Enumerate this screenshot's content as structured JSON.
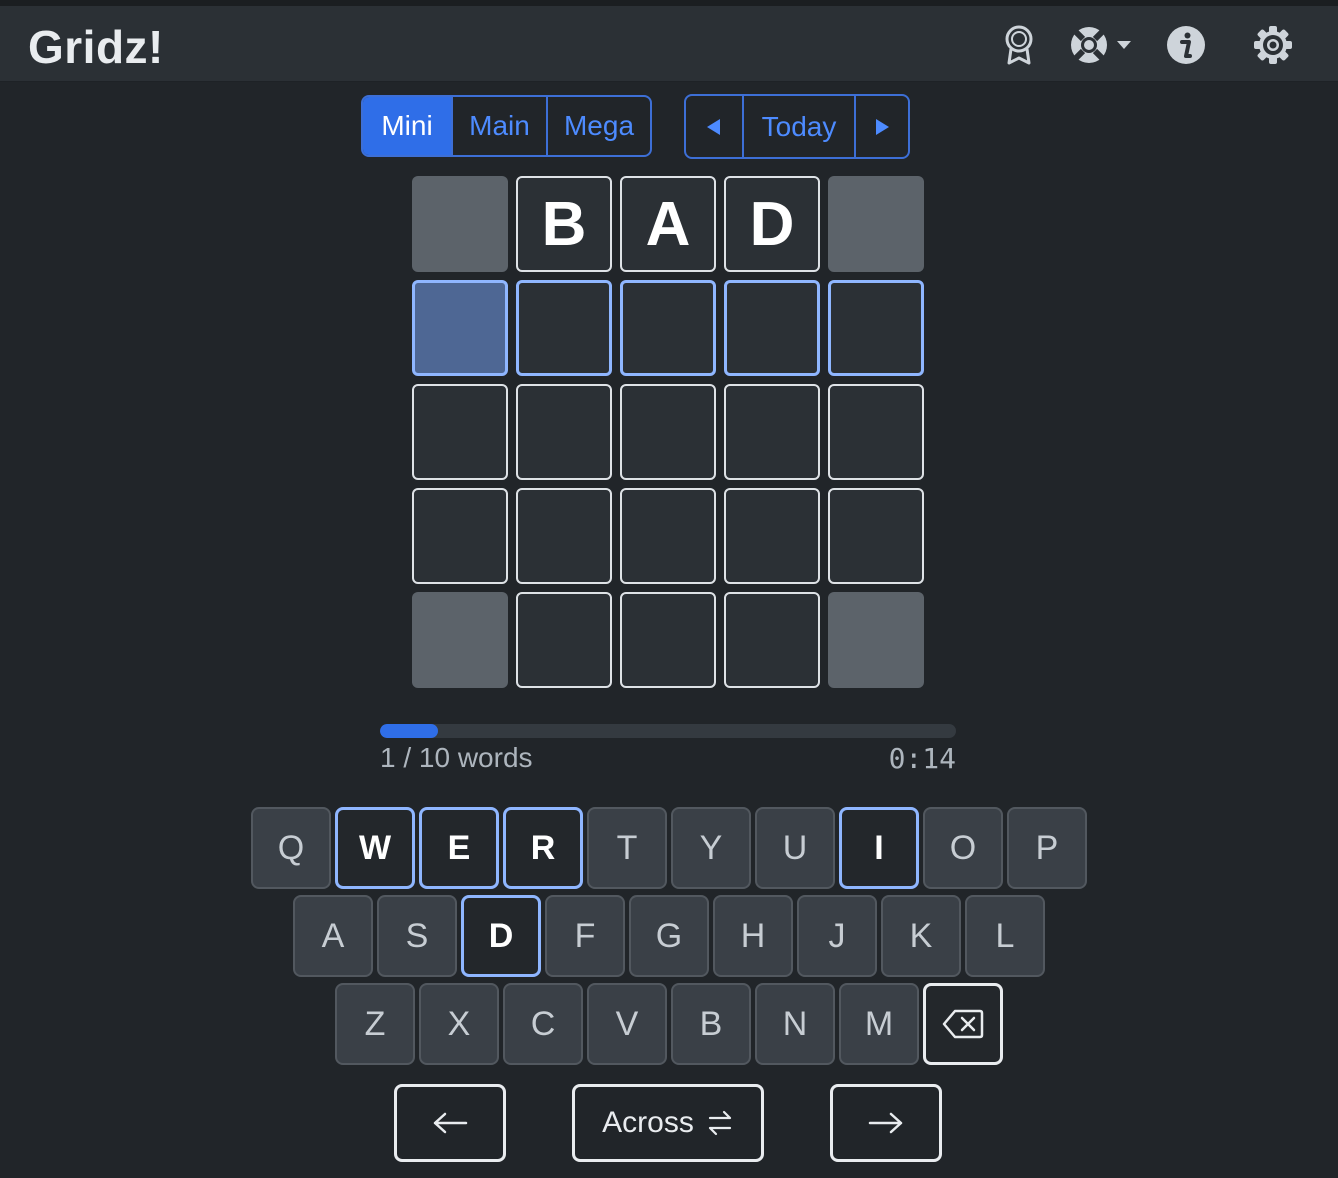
{
  "app": {
    "title": "Gridz!"
  },
  "navbar": {
    "icons": [
      "award-icon",
      "lifebuoy-icon",
      "info-icon",
      "gear-icon"
    ]
  },
  "modes": [
    {
      "label": "Mini",
      "active": true
    },
    {
      "label": "Main",
      "active": false
    },
    {
      "label": "Mega",
      "active": false
    }
  ],
  "date_nav": {
    "prev_icon": "caret-left-icon",
    "label": "Today",
    "next_icon": "caret-right-icon"
  },
  "grid": {
    "rows": [
      [
        {
          "type": "block"
        },
        {
          "type": "letter",
          "value": "B"
        },
        {
          "type": "letter",
          "value": "A"
        },
        {
          "type": "letter",
          "value": "D"
        },
        {
          "type": "block"
        }
      ],
      [
        {
          "type": "current",
          "value": ""
        },
        {
          "type": "active",
          "value": ""
        },
        {
          "type": "active",
          "value": ""
        },
        {
          "type": "active",
          "value": ""
        },
        {
          "type": "active",
          "value": ""
        }
      ],
      [
        {
          "type": "empty",
          "value": ""
        },
        {
          "type": "empty",
          "value": ""
        },
        {
          "type": "empty",
          "value": ""
        },
        {
          "type": "empty",
          "value": ""
        },
        {
          "type": "empty",
          "value": ""
        }
      ],
      [
        {
          "type": "empty",
          "value": ""
        },
        {
          "type": "empty",
          "value": ""
        },
        {
          "type": "empty",
          "value": ""
        },
        {
          "type": "empty",
          "value": ""
        },
        {
          "type": "empty",
          "value": ""
        }
      ],
      [
        {
          "type": "block"
        },
        {
          "type": "empty",
          "value": ""
        },
        {
          "type": "empty",
          "value": ""
        },
        {
          "type": "empty",
          "value": ""
        },
        {
          "type": "block"
        }
      ]
    ]
  },
  "progress": {
    "fraction": 0.1,
    "label": "1 / 10 words",
    "timer": "0:14"
  },
  "keyboard": {
    "rows": [
      [
        "Q",
        "W",
        "E",
        "R",
        "T",
        "Y",
        "U",
        "I",
        "O",
        "P"
      ],
      [
        "A",
        "S",
        "D",
        "F",
        "G",
        "H",
        "J",
        "K",
        "L"
      ],
      [
        "Z",
        "X",
        "C",
        "V",
        "B",
        "N",
        "M"
      ]
    ],
    "highlighted": [
      "W",
      "E",
      "R",
      "I",
      "D"
    ],
    "backspace_icon": "backspace-icon"
  },
  "controls": {
    "prev_icon": "arrow-left-icon",
    "direction_label": "Across",
    "direction_icon": "swap-arrows-icon",
    "next_icon": "arrow-right-icon"
  }
}
